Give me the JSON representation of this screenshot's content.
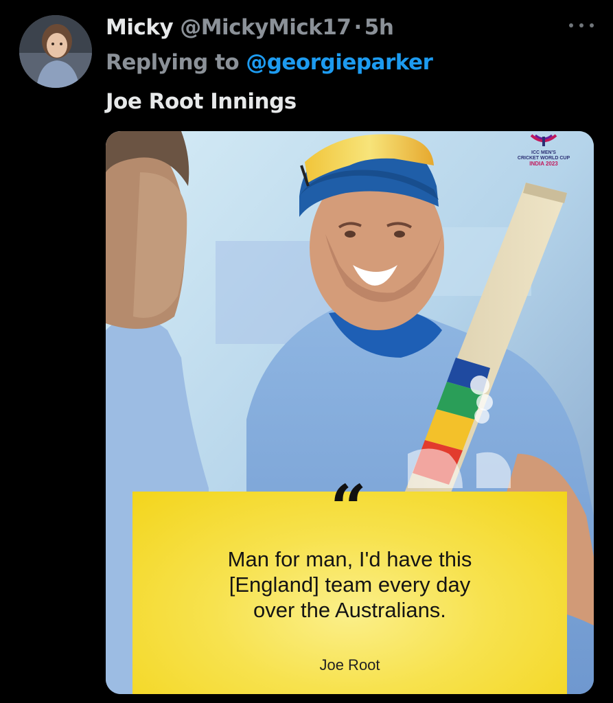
{
  "tweet": {
    "display_name": "Micky",
    "handle": "@MickyMick17",
    "separator": "·",
    "time": "5h",
    "reply_prefix": "Replying to",
    "reply_to": "@georgieparker",
    "text": "Joe Root Innings",
    "more_icon": "more-horizontal-icon"
  },
  "media": {
    "logo": {
      "line1": "ICC MEN'S",
      "line2": "CRICKET WORLD CUP",
      "line3": "INDIA 2023"
    },
    "quote": {
      "lines": [
        "Man for man, I'd have this",
        "[England] team every day",
        "over the Australians."
      ],
      "author": "Joe Root"
    }
  },
  "colors": {
    "background": "#000000",
    "link": "#1d9bf0",
    "secondary_text": "#8b9198",
    "quote_card": "#f7e24e"
  }
}
